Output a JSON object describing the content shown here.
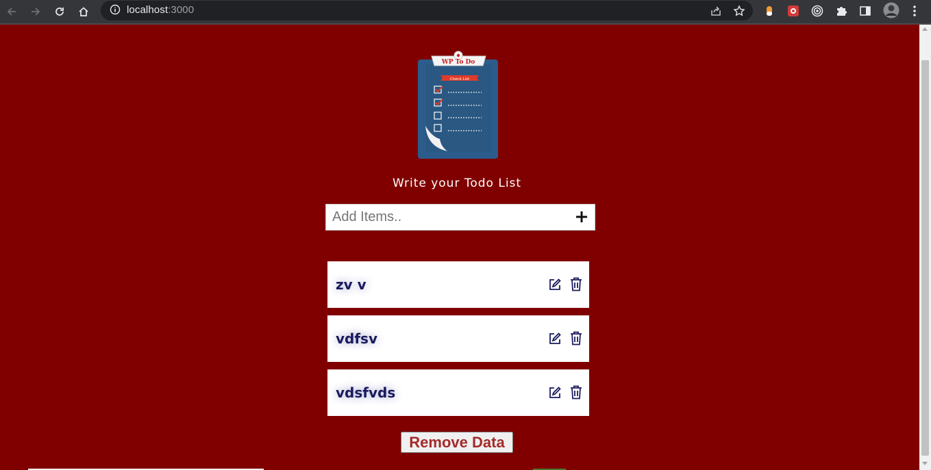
{
  "browser": {
    "url_host": "localhost",
    "url_port": ":3000"
  },
  "app": {
    "logo_text": "WP To Do",
    "logo_banner": "Check List",
    "heading": "Write your Todo List",
    "input_placeholder": "Add Items..",
    "items": [
      {
        "text": "zv v"
      },
      {
        "text": "vdfsv"
      },
      {
        "text": "vdsfvds"
      }
    ],
    "remove_label": "Remove Data"
  },
  "colors": {
    "background": "#800000",
    "item_text": "#1a1a5e",
    "remove_text": "#a52a2a"
  }
}
